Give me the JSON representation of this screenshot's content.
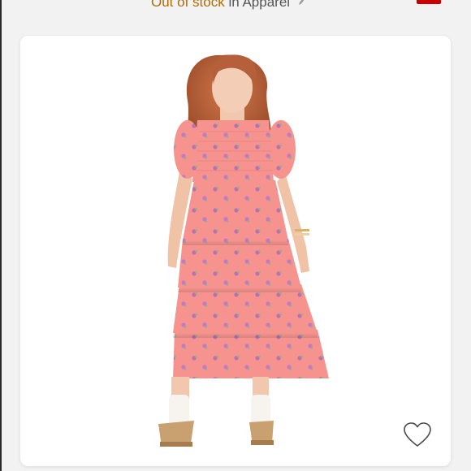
{
  "header": {
    "stock_status": "Out of stock",
    "separator": "in",
    "category": "Apparel",
    "edit_icon": "pencil-icon"
  },
  "product": {
    "image_subject": "model-wearing-pink-tiered-dress",
    "dress_color": "#f4928f",
    "favorite_icon": "heart-outline-icon"
  },
  "colors": {
    "stock_status": "#b26a00",
    "badge": "#cc0000",
    "card_background": "#ffffff",
    "page_background": "#f2f2f2"
  }
}
